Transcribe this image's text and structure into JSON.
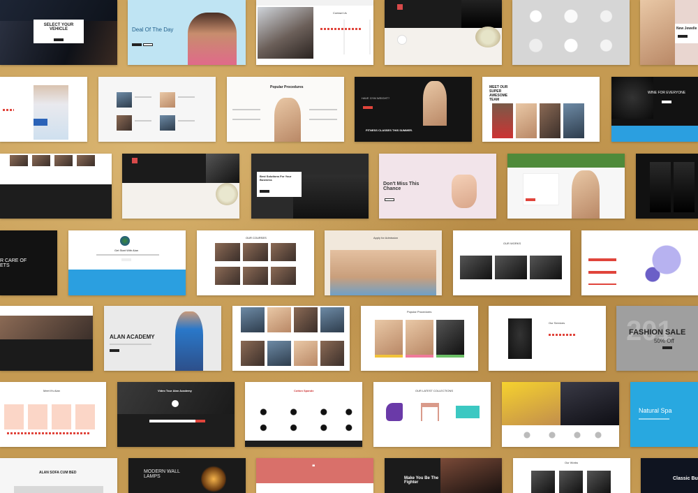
{
  "tiles": {
    "r1": {
      "vehicle_title": "SELECT YOUR VEHICLE",
      "deal_title": "Deal Of The Day",
      "contact_title": "Contact Us",
      "jewellery_title": "New Jewelle"
    },
    "r2": {
      "procedures_title": "Popular Procedures",
      "fitness_tag": "HAVE GYM WEIGHT?",
      "fitness_banner": "FITNESS CLASSES THIS SUMMER.",
      "team_title": "MEET OUR SUPER AWESOME TEAM",
      "wine_title": "WINE FOR EVERYONE"
    },
    "r3": {
      "business_title": "Best Solutions For Your Business",
      "miss_title": "Don't Miss This Chance"
    },
    "r4": {
      "care_title": "R CARE OF ETS",
      "start_title": "Get Start With Alan",
      "courses_title": "OUR COURSES",
      "apply_title": "Apply for Admission",
      "works_title": "OUR WORKS"
    },
    "r5": {
      "academy_title": "ALAN ACADEMY",
      "procedures_title": "Popular Procedures",
      "services_title": "Our Services",
      "fashion_title": "FASHION SALE",
      "fashion_off": "50% Off",
      "year_text": "201"
    },
    "r6": {
      "meet_title": "Meet It's Alan",
      "video_title": "Video Tour Alan Academy",
      "spandx_title": "Cotton Spandx",
      "latest_title": "OUR LATEST COLLECTIONS",
      "spa_title": "Natural Spa"
    },
    "r7": {
      "sofa_title": "ALAN SOFA CUM BED",
      "lamps_title": "MODERN WALL LAMPS",
      "quote_mark": "❝",
      "fighter_title": "Make You Be The Fighter",
      "works_title": "Our Works",
      "classic_title": "Classic Bu"
    }
  }
}
